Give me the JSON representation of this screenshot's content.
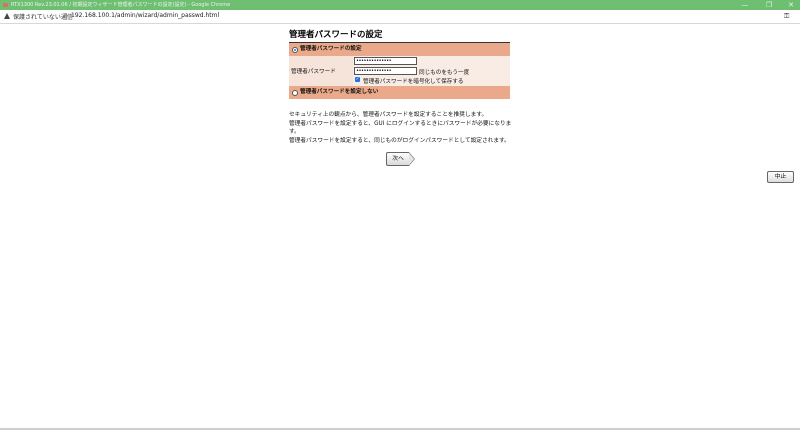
{
  "window": {
    "title": "RTX1300 Rev.23.01.06 / 初期設定ウィザード管理者パスワードの設定(設定) - Google Chrome",
    "minimize": "—",
    "maximize": "❐",
    "close": "✕"
  },
  "address_bar": {
    "security_label": "保護されていない通信",
    "url": "192.168.100.1/admin/wizard/admin_passwd.html"
  },
  "page": {
    "title": "管理者パスワードの設定",
    "option_set_label": "管理者パスワードの設定",
    "password_field_label": "管理者パスワード",
    "password_value": "••••••••••••••",
    "password_confirm_value": "••••••••••••••",
    "confirm_label": "同じものをもう一度",
    "encrypt_checkbox_label": "管理者パスワードを暗号化して保存する",
    "encrypt_checked": true,
    "option_unset_label": "管理者パスワードを設定しない",
    "selected_option": "set",
    "description": [
      "セキュリティ上の観点から、管理者パスワードを設定することを推奨します。",
      "管理者パスワードを設定すると、GUI にログインするときにパスワードが必要になりま",
      "す。",
      "管理者パスワードを設定すると、同じものがログインパスワードとして設定されます。"
    ],
    "next_button": "次へ",
    "cancel_button": "中止"
  },
  "colors": {
    "titlebar": "#6fbf73",
    "section_header": "#e9a98a",
    "form_background": "#f6e4db",
    "accent": "#1a73e8"
  }
}
